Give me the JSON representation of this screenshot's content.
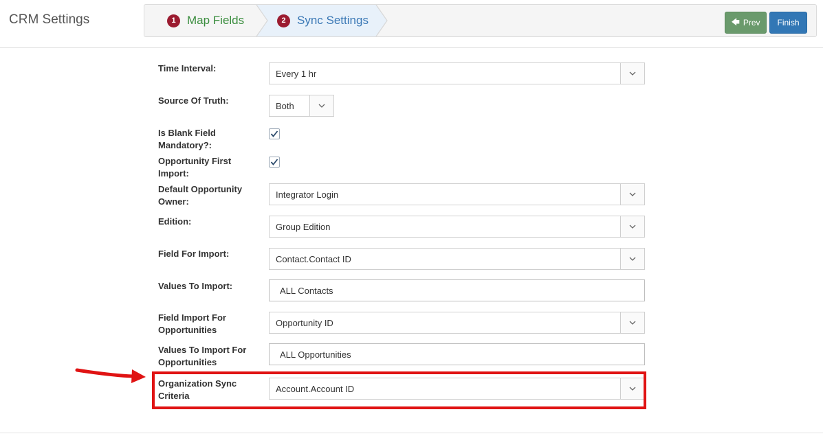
{
  "header": {
    "title": "CRM Settings",
    "steps": [
      {
        "number": "1",
        "label": "Map Fields"
      },
      {
        "number": "2",
        "label": "Sync Settings"
      }
    ],
    "prev_label": "Prev",
    "finish_label": "Finish"
  },
  "colors": {
    "step_badge": "#9b1b30",
    "step_done": "#3a8d3e",
    "step_active": "#3a78b5",
    "prev_button": "#6a9a6c",
    "finish_button": "#3277b5",
    "highlight": "#e01313"
  },
  "form": {
    "time_interval": {
      "label": "Time Interval:",
      "value": "Every 1 hr"
    },
    "source_of_truth": {
      "label": "Source Of Truth:",
      "value": "Both"
    },
    "blank_field_mandatory": {
      "label": "Is Blank Field Mandatory?:",
      "checked": true
    },
    "opportunity_first_import": {
      "label": "Opportunity First Import:",
      "checked": true
    },
    "default_opportunity_owner": {
      "label": "Default Opportunity Owner:",
      "value": "Integrator Login"
    },
    "edition": {
      "label": "Edition:",
      "value": "Group Edition"
    },
    "field_for_import": {
      "label": "Field For Import:",
      "value": "Contact.Contact ID"
    },
    "values_to_import": {
      "label": "Values To Import:",
      "value": "ALL Contacts"
    },
    "field_import_for_opportunities": {
      "label": "Field Import For Opportunities",
      "value": "Opportunity ID"
    },
    "values_to_import_for_opportunities": {
      "label": "Values To Import For Opportunities",
      "value": "ALL Opportunities"
    },
    "organization_sync_criteria": {
      "label": "Organization Sync Criteria",
      "value": "Account.Account ID"
    }
  }
}
